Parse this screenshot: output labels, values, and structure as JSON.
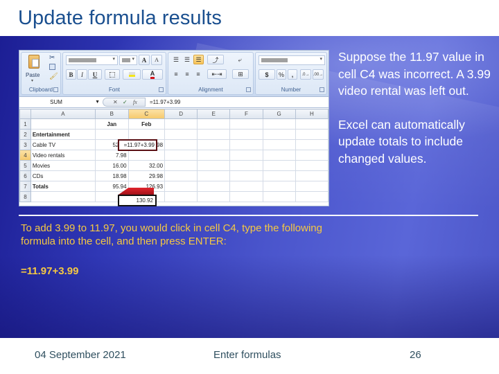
{
  "slide": {
    "title": "Update formula results",
    "right_paragraphs": [
      "Suppose the 11.97 value in cell C4 was incorrect. A 3.99 video rental was left out.",
      "Excel can automatically update totals to include changed values."
    ],
    "instruction": "To add 3.99 to 11.97, you would click in cell C4, type the following formula into the cell, and then press ENTER:",
    "formula_example": "=11.97+3.99",
    "footer": {
      "date": "04 September 2021",
      "topic": "Enter formulas",
      "page_number": "26"
    },
    "colors": {
      "title": "#1a4f8f",
      "accent_text": "#f5c842",
      "panel_blue": "#3038b6"
    }
  },
  "excel": {
    "ribbon": {
      "groups": [
        {
          "name": "clipboard",
          "label": "Clipboard"
        },
        {
          "name": "font",
          "label": "Font"
        },
        {
          "name": "alignment",
          "label": "Alignment"
        },
        {
          "name": "number",
          "label": "Number"
        }
      ],
      "paste_label": "Paste",
      "bold": "B",
      "italic": "I",
      "underline": "U",
      "grow_font": "A",
      "shrink_font": "A",
      "currency": "$",
      "percent": "%",
      "comma": ","
    },
    "formula_bar": {
      "name_box": "SUM",
      "cancel": "✕",
      "enter": "✓",
      "fx": "fx",
      "formula": "=11.97+3.99"
    },
    "columns": [
      "A",
      "B",
      "C",
      "D",
      "E",
      "F",
      "G",
      "H"
    ],
    "rows": [
      {
        "n": "1",
        "cells": [
          "",
          "Jan",
          "Feb",
          "",
          "",
          "",
          "",
          ""
        ]
      },
      {
        "n": "2",
        "cells": [
          "Entertainment",
          "",
          "",
          "",
          "",
          "",
          "",
          ""
        ]
      },
      {
        "n": "3",
        "cells": [
          "Cable TV",
          "52.98",
          "52.98",
          "",
          "",
          "",
          "",
          ""
        ]
      },
      {
        "n": "4",
        "cells": [
          "Video rentals",
          "7.98",
          "=11.97+3.99",
          "",
          "",
          "",
          "",
          ""
        ]
      },
      {
        "n": "5",
        "cells": [
          "Movies",
          "16.00",
          "32.00",
          "",
          "",
          "",
          "",
          ""
        ]
      },
      {
        "n": "6",
        "cells": [
          "CDs",
          "18.98",
          "29.98",
          "",
          "",
          "",
          "",
          ""
        ]
      },
      {
        "n": "7",
        "cells": [
          "Totals",
          "95.94",
          "126.93",
          "",
          "",
          "",
          "",
          ""
        ]
      },
      {
        "n": "8",
        "cells": [
          "",
          "",
          "",
          "",
          "",
          "",
          "",
          ""
        ]
      }
    ],
    "active_cell": "C4",
    "updated_total": "130.92"
  }
}
